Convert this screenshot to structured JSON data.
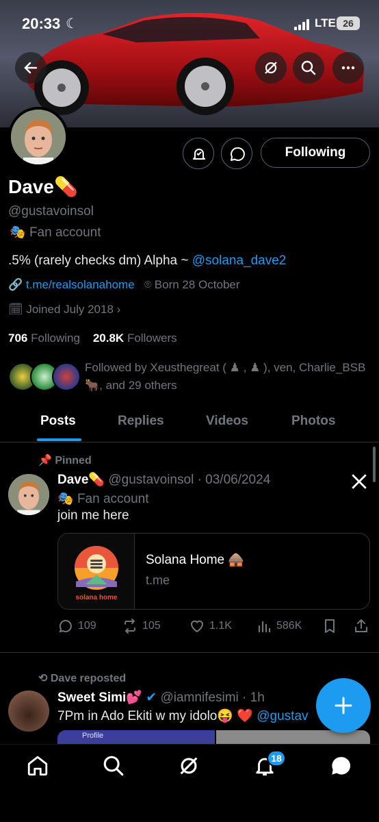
{
  "status_bar": {
    "time": "20:33",
    "network": "LTE",
    "battery": "26"
  },
  "profile": {
    "name": "Dave",
    "handle": "@gustavoinsol",
    "category": "Fan account",
    "bio_text": ".5% (rarely checks dm) Alpha ~ ",
    "bio_mention": "@solana_dave2",
    "website": "t.me/realsolanahome",
    "born": "Born 28 October",
    "joined": "Joined July 2018",
    "following_count": "706",
    "following_label": "Following",
    "followers_count": "20.8K",
    "followers_label": "Followers",
    "followed_by_text": "Followed by Xeusthegreat ( ♟ , ♟ ), ven, Charlie_BSB 🐂, and 29 others",
    "follow_button_label": "Following"
  },
  "tabs": [
    {
      "label": "Posts",
      "active": true
    },
    {
      "label": "Replies",
      "active": false
    },
    {
      "label": "Videos",
      "active": false
    },
    {
      "label": "Photos",
      "active": false
    }
  ],
  "pinned_post": {
    "pinned_label": "Pinned",
    "author": "Dave",
    "handle_date": "@gustavoinsol · 03/06/2024",
    "category": "Fan account",
    "text": "join me here",
    "card": {
      "title": "Solana Home 🛖",
      "domain": "t.me",
      "logo_text": "solana home"
    },
    "replies": "109",
    "reposts": "105",
    "likes": "1.1K",
    "views": "586K"
  },
  "repost": {
    "reposted_label": "Dave reposted",
    "author": "Sweet Simi💕",
    "handle_time": "@iamnifesimi · 1h",
    "text": "7Pm in Ado Ekiti w my idolo😝 ❤️ ",
    "mention": "@gustav",
    "media_label": "Profile"
  },
  "bottom_nav": {
    "notifications_badge": "18"
  },
  "colors": {
    "accent": "#1d9bf0",
    "background": "#000000",
    "secondary_text": "#71767b"
  }
}
